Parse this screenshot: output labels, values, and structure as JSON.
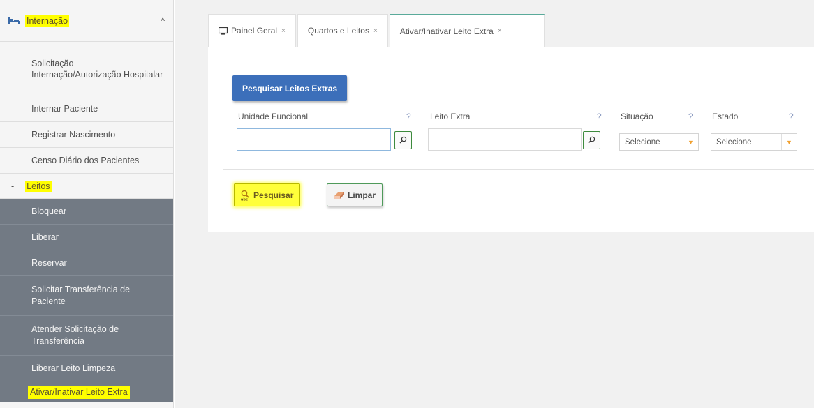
{
  "sidebar": {
    "section_title": "Internação",
    "items": [
      {
        "label": "Solicitação Internação/Autorização Hospitalar"
      },
      {
        "label": "Internar Paciente"
      },
      {
        "label": "Registrar Nascimento"
      },
      {
        "label": "Censo Diário dos Pacientes"
      }
    ],
    "group_dash": "-",
    "group_label": "Leitos",
    "sub_items": [
      {
        "label": "Bloquear"
      },
      {
        "label": "Liberar"
      },
      {
        "label": "Reservar"
      },
      {
        "label": "Solicitar Transferência de Paciente"
      },
      {
        "label": "Atender Solicitação de Transferência"
      },
      {
        "label": "Liberar Leito Limpeza"
      },
      {
        "label": "Ativar/Inativar Leito Extra"
      }
    ]
  },
  "tabs": [
    {
      "label": "Painel Geral",
      "close": "×"
    },
    {
      "label": "Quartos e Leitos",
      "close": "×"
    },
    {
      "label": "Ativar/Inativar Leito Extra",
      "close": "×"
    }
  ],
  "search_panel": {
    "legend": "Pesquisar Leitos Extras",
    "help_glyph": "?",
    "fields": {
      "unidade_label": "Unidade Funcional",
      "unidade_value": "",
      "leito_label": "Leito Extra",
      "leito_value": "",
      "situacao_label": "Situação",
      "situacao_value": "Selecione",
      "estado_label": "Estado",
      "estado_value": "Selecione"
    },
    "buttons": {
      "search": "Pesquisar",
      "clear": "Limpar"
    }
  },
  "colors": {
    "highlight": "#ffff00",
    "legend_bg": "#3c6fba",
    "submenu_bg": "#727a84",
    "active_tab_accent": "#5aaa9a"
  },
  "icons": {
    "section": "bed-icon",
    "collapse": "chevron-up-icon",
    "tab_home": "monitor-icon",
    "lookup": "magnifier-icon",
    "search_button": "search-magnifier-icon",
    "clear_button": "eraser-icon",
    "dropdown": "caret-down-icon"
  }
}
